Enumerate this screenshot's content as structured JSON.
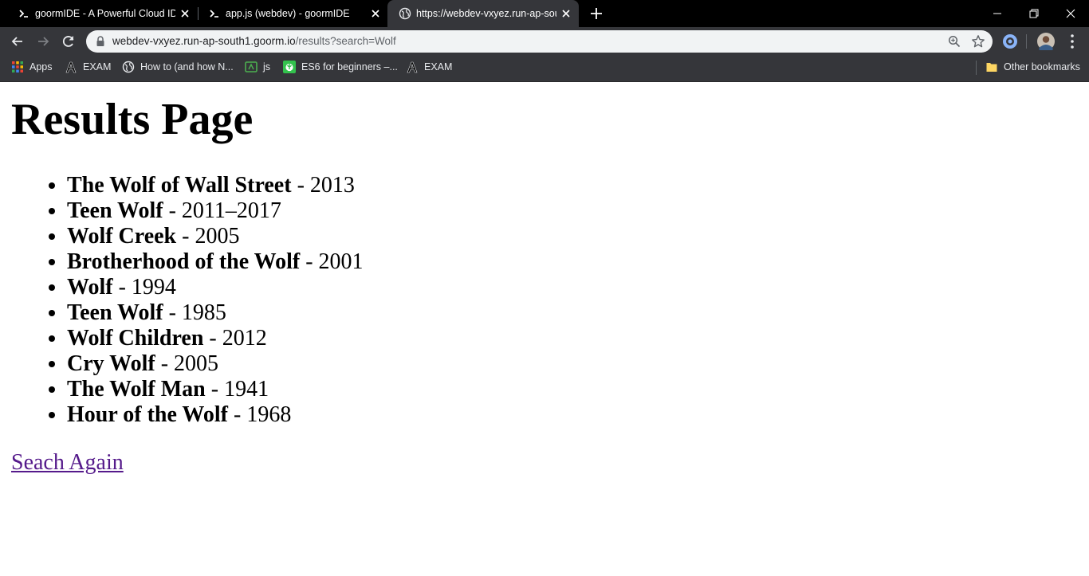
{
  "browser": {
    "tabs": [
      {
        "title": "goormIDE - A Powerful Cloud IDE",
        "icon": "terminal-icon",
        "active": false
      },
      {
        "title": "app.js (webdev) - goormIDE",
        "icon": "terminal-icon",
        "active": false
      },
      {
        "title": "https://webdev-vxyez.run-ap-south1.goorm.io/results?search=Wolf",
        "icon": "globe-icon",
        "active": true
      }
    ],
    "address": {
      "host": "webdev-vxyez.run-ap-south1.goorm.io",
      "path": "/results?search=Wolf"
    },
    "bookmarks": [
      {
        "label": "Apps",
        "icon": "apps-grid-icon"
      },
      {
        "label": "EXAM",
        "icon": "letter-a-icon"
      },
      {
        "label": "How to (and how N...",
        "icon": "globe-icon"
      },
      {
        "label": "js",
        "icon": "js-icon"
      },
      {
        "label": "ES6 for beginners –...",
        "icon": "rebel-icon"
      },
      {
        "label": "EXAM",
        "icon": "letter-a-icon"
      }
    ],
    "other_bookmarks": "Other bookmarks",
    "colors": {
      "tabstrip": "#000000",
      "toolbar": "#35363a",
      "omnibox": "#f1f3f4"
    }
  },
  "page": {
    "heading": "Results Page",
    "separator": " - ",
    "results": [
      {
        "title": "The Wolf of Wall Street",
        "year": "2013"
      },
      {
        "title": "Teen Wolf",
        "year": "2011–2017"
      },
      {
        "title": "Wolf Creek",
        "year": "2005"
      },
      {
        "title": "Brotherhood of the Wolf",
        "year": "2001"
      },
      {
        "title": "Wolf",
        "year": "1994"
      },
      {
        "title": "Teen Wolf",
        "year": "1985"
      },
      {
        "title": "Wolf Children",
        "year": "2012"
      },
      {
        "title": "Cry Wolf",
        "year": "2005"
      },
      {
        "title": "The Wolf Man",
        "year": "1941"
      },
      {
        "title": "Hour of the Wolf",
        "year": "1968"
      }
    ],
    "search_again": "Seach Again",
    "link_color": "#551a8b"
  }
}
